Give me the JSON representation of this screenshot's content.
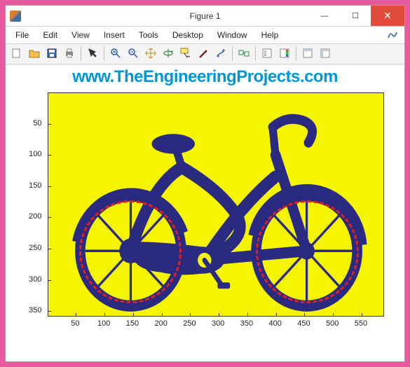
{
  "window": {
    "title": "Figure 1",
    "controls": {
      "minimize": "—",
      "maximize": "☐",
      "close": "✕"
    }
  },
  "menu": {
    "items": [
      "File",
      "Edit",
      "View",
      "Insert",
      "Tools",
      "Desktop",
      "Window",
      "Help"
    ]
  },
  "toolbar": {
    "buttons": [
      "new-figure",
      "open-file",
      "save",
      "print",
      "_sep",
      "pointer",
      "_sep",
      "zoom-in",
      "zoom-out",
      "pan",
      "rotate-3d",
      "data-cursor",
      "brush",
      "colorbar",
      "_sep",
      "link-plot",
      "_sep",
      "insert-legend",
      "insert-colorbar",
      "_sep",
      "hide-tools",
      "show-tools"
    ]
  },
  "watermark": "www.TheEngineeringProjects.com",
  "chart_data": {
    "type": "image-plot",
    "xlabel": "",
    "ylabel": "",
    "xlim": [
      1,
      590
    ],
    "ylim": [
      1,
      360
    ],
    "x_ticks": [
      50,
      100,
      150,
      200,
      250,
      300,
      350,
      400,
      450,
      500,
      550
    ],
    "y_ticks": [
      50,
      100,
      150,
      200,
      250,
      300,
      350
    ],
    "image_subject": "bicycle silhouette (navy on yellow)",
    "image_colors": {
      "background": "#f5f500",
      "foreground": "#2a2a80"
    },
    "detected_circles": [
      {
        "cx": 145,
        "cy": 255,
        "r": 90,
        "style": "red-dashed"
      },
      {
        "cx": 455,
        "cy": 255,
        "r": 90,
        "style": "red-dashed"
      }
    ]
  }
}
